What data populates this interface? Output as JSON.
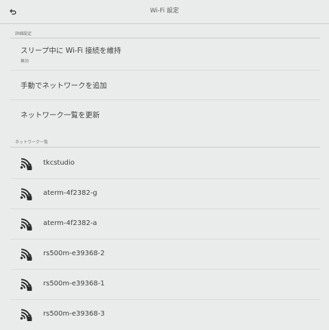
{
  "header": {
    "title": "Wi-Fi 設定",
    "back_icon": "back-arrow-icon"
  },
  "advanced": {
    "section_label": "詳細設定",
    "keep_wifi": {
      "label": "スリープ中に Wi-Fi 接続を維持",
      "value": "無効"
    },
    "add_network": {
      "label": "手動でネットワークを追加"
    },
    "refresh": {
      "label": "ネットワーク一覧を更新"
    }
  },
  "networks": {
    "section_label": "ネットワーク一覧",
    "icon": "wifi-locked-icon",
    "items": [
      {
        "name": "tkcstudio"
      },
      {
        "name": "aterm-4f2382-g"
      },
      {
        "name": "aterm-4f2382-a"
      },
      {
        "name": "rs500m-e39368-2"
      },
      {
        "name": "rs500m-e39368-1"
      },
      {
        "name": "rs500m-e39368-3"
      }
    ]
  }
}
